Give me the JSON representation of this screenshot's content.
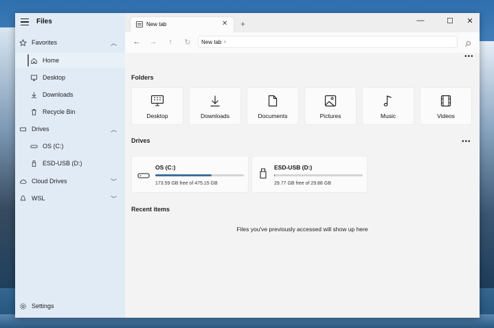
{
  "app": {
    "title": "Files"
  },
  "sidebar": {
    "items": [
      {
        "label": "Favorites",
        "icon": "star-icon",
        "expanded": true
      },
      {
        "label": "Home",
        "icon": "home-icon",
        "selected": true
      },
      {
        "label": "Desktop",
        "icon": "desktop-icon"
      },
      {
        "label": "Downloads",
        "icon": "download-icon"
      },
      {
        "label": "Recycle Bin",
        "icon": "recycle-bin-icon"
      },
      {
        "label": "Drives",
        "icon": "drive-icon",
        "expanded": true
      },
      {
        "label": "OS (C:)",
        "icon": "hard-drive-icon"
      },
      {
        "label": "ESD-USB (D:)",
        "icon": "usb-icon"
      },
      {
        "label": "Cloud Drives",
        "icon": "cloud-icon",
        "expanded": false
      },
      {
        "label": "WSL",
        "icon": "linux-icon",
        "expanded": false
      }
    ],
    "settings_label": "Settings"
  },
  "tabs": [
    {
      "label": "New tab",
      "icon": "tab-icon"
    }
  ],
  "address": {
    "label": "New tab"
  },
  "sections": {
    "folders": "Folders",
    "drives": "Drives",
    "recent": "Recent items"
  },
  "folders": [
    {
      "label": "Desktop",
      "icon": "desktop-icon"
    },
    {
      "label": "Downloads",
      "icon": "download-icon"
    },
    {
      "label": "Documents",
      "icon": "document-icon"
    },
    {
      "label": "Pictures",
      "icon": "picture-icon"
    },
    {
      "label": "Music",
      "icon": "music-icon"
    },
    {
      "label": "Videos",
      "icon": "video-icon"
    }
  ],
  "drives": [
    {
      "name": "OS (C:)",
      "free_text": "173.59 GB free of 475.15 GB",
      "used_fraction": 0.635,
      "icon": "hard-drive-icon"
    },
    {
      "name": "ESD-USB (D:)",
      "free_text": "29.77 GB free of 29.88 GB",
      "used_fraction": 0.004,
      "icon": "usb-icon"
    }
  ],
  "recent": {
    "empty_message": "Files you've previously accessed will show up here"
  },
  "colors": {
    "accent": "#3f6e9b",
    "sidebar_bg": "#deeaf5",
    "content_bg": "#f3f3f3"
  }
}
